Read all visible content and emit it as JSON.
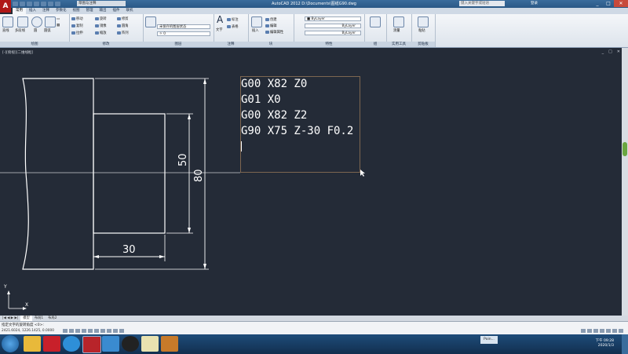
{
  "titlebar": {
    "app_button": "A",
    "workspace": "草图与注释",
    "title": "AutoCAD 2012    D:\\Documents\\图纸G90.dwg",
    "search_placeholder": "键入关键字或短语",
    "login": "登录",
    "minimize": "_",
    "maximize": "□",
    "close": "✕"
  },
  "tabs": [
    "常用",
    "插入",
    "注释",
    "参数化",
    "视图",
    "管理",
    "输出",
    "插件",
    "联机"
  ],
  "ribbon": {
    "draw": {
      "label": "绘图",
      "line": "直线",
      "polyline": "多段线",
      "circle": "圆",
      "arc": "圆弧"
    },
    "modify": {
      "label": "修改",
      "move": "移动",
      "rotate": "旋转",
      "trim": "修剪",
      "copy": "复制",
      "mirror": "镜像",
      "fillet": "圆角",
      "stretch": "拉伸",
      "scale": "缩放",
      "array": "阵列"
    },
    "layers": {
      "label": "图层",
      "state": "未保存的图层状态",
      "layer_name": "0"
    },
    "annotation": {
      "label": "注释",
      "text": "文字",
      "dimension": "标注",
      "table": "表格"
    },
    "block": {
      "label": "块",
      "insert": "插入",
      "create": "创建",
      "edit": "编辑",
      "edit_attr": "编辑属性"
    },
    "properties": {
      "label": "特性",
      "color": "ByLayer",
      "linetype": "ByLayer",
      "lineweight": "ByLayer"
    },
    "groups": {
      "label": "组"
    },
    "utilities": {
      "label": "实用工具",
      "measure": "测量"
    },
    "clipboard": {
      "label": "剪贴板",
      "paste": "粘贴"
    }
  },
  "viewport": {
    "label": "[-][俯视][二维线框]",
    "controls": [
      "_",
      "□",
      "✕"
    ]
  },
  "drawing": {
    "gcode_lines": [
      "G00 X82 Z0",
      "G01 X0",
      "G00 X82 Z2",
      "G90 X75 Z-30 F0.2"
    ],
    "dim_50": "50",
    "dim_80": "80",
    "dim_30": "30",
    "ucs_y": "Y",
    "ucs_x": "X"
  },
  "layout_tabs": [
    "模型",
    "布局1",
    "布局2"
  ],
  "command": {
    "prompt": "指定文字的旋转角度 <0>:",
    "coords": "2421.6024, 1226.1425, 0.0000"
  },
  "taskbar": {
    "pinned_item": "Poin...",
    "time": "下午 09:28",
    "date": "2020/1/3"
  },
  "colors": {
    "canvas": "#242b37",
    "drawing_line": "#ffffff",
    "mtext_frame": "#7d6650",
    "title_bar": "#2a5886"
  }
}
